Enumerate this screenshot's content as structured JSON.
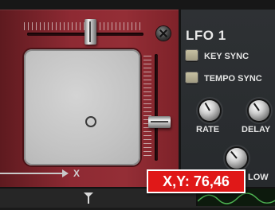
{
  "xy_pad": {
    "x_axis_label": "X",
    "x_percent": 76,
    "y_percent": 46
  },
  "lfo": {
    "title": "LFO 1",
    "key_sync_label": "KEY SYNC",
    "tempo_sync_label": "TEMPO SYNC",
    "rate_label": "RATE",
    "delay_label": "DELAY",
    "slow_label": "LOW"
  },
  "tooltip": {
    "text": "X,Y: 76,46"
  },
  "colors": {
    "panel_red": "#942e36",
    "tooltip_red": "#e01818",
    "lfo_panel": "#2e3134",
    "display_green": "#4caf50"
  },
  "icons": {
    "screw": "screw-icon",
    "x_arrow": "arrow-right-icon",
    "bottom_marker": "pin-marker-icon"
  }
}
